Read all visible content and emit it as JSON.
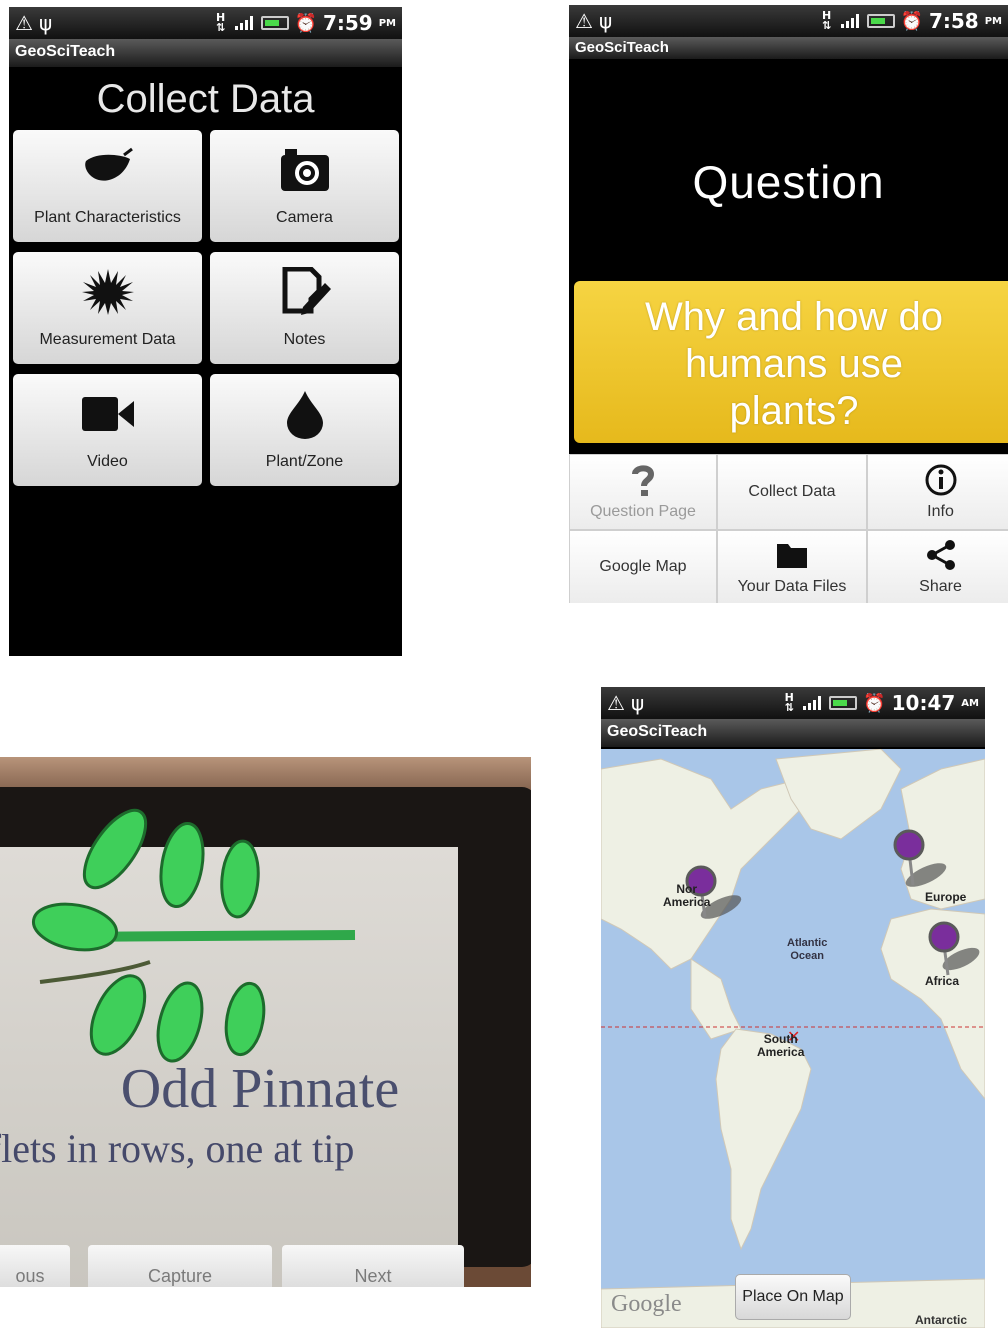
{
  "app_name": "GeoSciTeach",
  "collect_screen": {
    "time": "7:59",
    "ampm": "PM",
    "heading": "Collect Data",
    "tiles": [
      {
        "label": "Plant Characteristics",
        "icon": "leaf-icon"
      },
      {
        "label": "Camera",
        "icon": "camera-icon"
      },
      {
        "label": "Measurement Data",
        "icon": "starburst-icon"
      },
      {
        "label": "Notes",
        "icon": "note-edit-icon"
      },
      {
        "label": "Video",
        "icon": "video-camera-icon"
      },
      {
        "label": "Plant/Zone",
        "icon": "water-drop-icon"
      }
    ]
  },
  "question_screen": {
    "time": "7:58",
    "ampm": "PM",
    "heading": "Question",
    "question_lines": [
      "Why and how do",
      "humans use",
      "plants?"
    ],
    "menu": [
      {
        "label": "Question Page",
        "icon": "question-mark-icon"
      },
      {
        "label": "Collect Data",
        "icon": ""
      },
      {
        "label": "Info",
        "icon": "info-icon"
      },
      {
        "label": "Google Map",
        "icon": ""
      },
      {
        "label": "Your Data Files",
        "icon": "folder-icon"
      },
      {
        "label": "Share",
        "icon": "share-icon"
      }
    ],
    "accent_color": "#f0c82e"
  },
  "photo_screen": {
    "title": "Odd Pinnate",
    "subtitle": "aflets in rows, one at tip",
    "buttons": [
      "ous",
      "Capture",
      "Next"
    ]
  },
  "map_screen": {
    "time": "10:47",
    "ampm": "AM",
    "labels": {
      "north_america": [
        "Nor",
        "America"
      ],
      "atlantic": [
        "Atlantic",
        "Ocean"
      ],
      "europe": "Europe",
      "africa": "Africa",
      "south_america": [
        "South",
        "America"
      ],
      "antarctic": "Antarctic"
    },
    "google": "Google",
    "place_button": "Place On Map",
    "pin_color": "#7a2e9c"
  }
}
